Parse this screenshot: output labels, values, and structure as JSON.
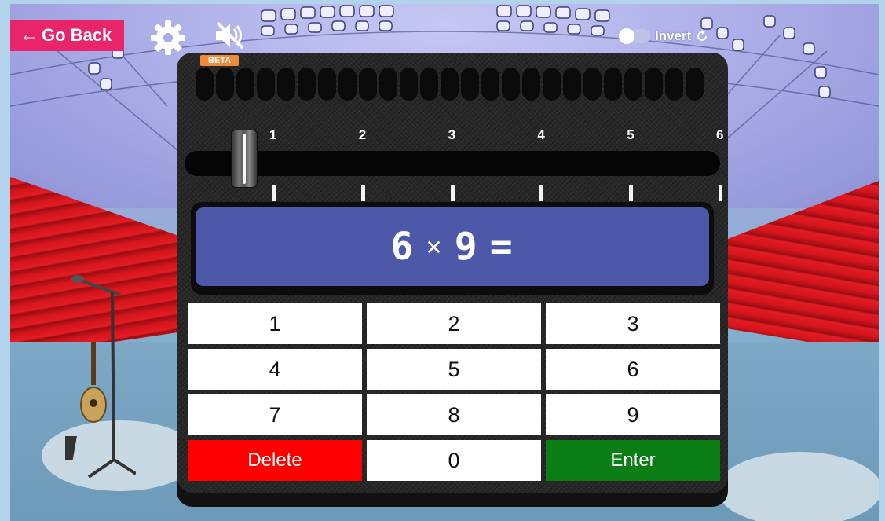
{
  "header": {
    "back_label": "Go Back",
    "back_arrow": "←",
    "settings_icon": "gear-icon",
    "mute_icon": "speaker-muted-icon",
    "invert_label": "Invert",
    "invert_toggle_on": false,
    "invert_icon": "rotate-icon"
  },
  "device": {
    "badge": "BETA",
    "slider": {
      "tick_labels": [
        "1",
        "2",
        "3",
        "4",
        "5",
        "6"
      ],
      "value": 1
    },
    "display": {
      "left": "6",
      "operator": "×",
      "right": "9",
      "equals": "="
    },
    "keypad": {
      "keys": [
        "1",
        "2",
        "3",
        "4",
        "5",
        "6",
        "7",
        "8",
        "9"
      ],
      "delete_label": "Delete",
      "zero_label": "0",
      "enter_label": "Enter"
    },
    "colors": {
      "display": "#4d59a8",
      "delete": "#ff0000",
      "enter": "#0a7d14",
      "back_button": "#e8256a",
      "beta_badge": "#f08a3a"
    }
  }
}
